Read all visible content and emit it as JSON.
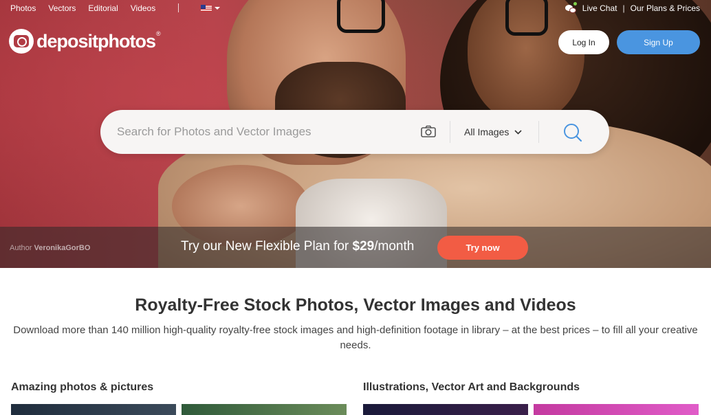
{
  "nav": {
    "links": [
      "Photos",
      "Vectors",
      "Editorial",
      "Videos"
    ],
    "live_chat": "Live Chat",
    "plans": "Our Plans & Prices",
    "separator": "|"
  },
  "logo": {
    "text": "depositphotos",
    "reg": "®"
  },
  "auth": {
    "login": "Log In",
    "signup": "Sign Up"
  },
  "search": {
    "placeholder": "Search for Photos and Vector Images",
    "type_selected": "All Images"
  },
  "promo": {
    "author_label": "Author",
    "author_name": "VeronikaGorBO",
    "text_pre": "Try our New Flexible Plan for ",
    "price": "$29",
    "text_post": "/month",
    "cta": "Try now"
  },
  "content": {
    "title": "Royalty-Free Stock Photos, Vector Images and Videos",
    "subtitle": "Download more than 140 million high-quality royalty-free stock images and high-definition footage in library – at the best prices – to fill all your creative needs.",
    "section_left": "Amazing photos & pictures",
    "section_right": "Illustrations, Vector Art and Backgrounds"
  },
  "colors": {
    "signup": "#4a95e0",
    "try_now": "#f25c44",
    "hero": "#a0343b"
  }
}
